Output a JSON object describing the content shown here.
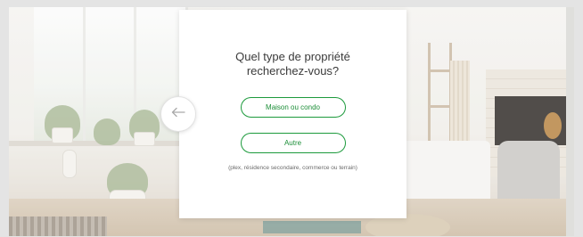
{
  "modal": {
    "title": "Quel type de propriété recherchez-vous?",
    "options": [
      {
        "label": "Maison ou condo"
      },
      {
        "label": "Autre"
      }
    ],
    "note": "(plex, résidence secondaire, commerce ou terrain)"
  },
  "back_button": {
    "icon": "arrow-left-icon"
  },
  "colors": {
    "accent": "#1c9a3c",
    "modal_background": "#ffffff",
    "frame": "#e4e4e4"
  }
}
